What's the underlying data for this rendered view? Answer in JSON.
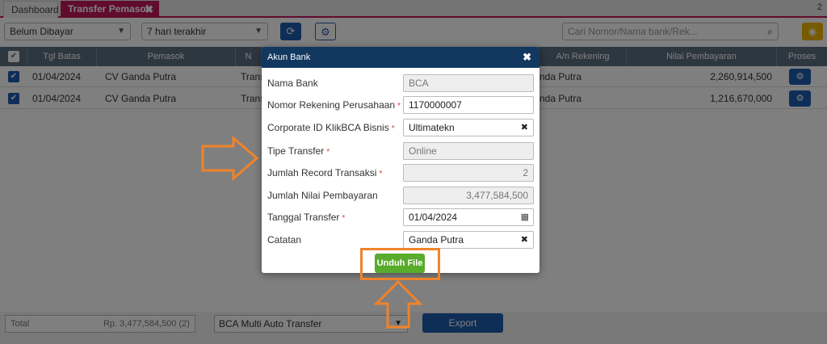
{
  "tabs": [
    {
      "label": "Dashboard"
    },
    {
      "label": "Transfer Pemasok",
      "close": "✖"
    }
  ],
  "tab_count": "2",
  "toolbar": {
    "status_value": "Belum Dibayar",
    "range_value": "7 hari terakhir",
    "search_placeholder": "Cari Nomor/Nama bank/Rek..."
  },
  "table": {
    "columns": [
      "Tgl Batas Transfer",
      "Pemasok",
      "N",
      "A/n Rekening",
      "Nilai Pembayaran",
      "Proses"
    ],
    "rows": [
      {
        "date": "01/04/2024",
        "supplier": "CV Ganda Putra",
        "method": "Trans",
        "account_name": "nda Putra",
        "amount": "2,260,914,500"
      },
      {
        "date": "01/04/2024",
        "supplier": "CV Ganda Putra",
        "method": "Trans",
        "account_name": "nda Putra",
        "amount": "1,216,670,000"
      }
    ]
  },
  "footer": {
    "total_label": "Total",
    "total_value": "Rp. 3,477,584,500 (2)",
    "method_value": "BCA Multi Auto Transfer",
    "export_label": "Export"
  },
  "modal": {
    "title": "Akun Bank",
    "close": "✖",
    "fields": [
      {
        "label": "Nama Bank",
        "value": "BCA",
        "required": false
      },
      {
        "label": "Nomor Rekening Perusahaan",
        "value": "1170000007",
        "required": true
      },
      {
        "label": "Corporate ID KlikBCA Bisnis",
        "value": "Ultimatekn",
        "required": true
      },
      {
        "label": "Tipe Transfer",
        "value": "Online",
        "required": true
      },
      {
        "label": "Jumlah Record Transaksi",
        "value": "2",
        "required": true
      },
      {
        "label": "Jumlah Nilai Pembayaran",
        "value": "3,477,584,500",
        "required": false
      },
      {
        "label": "Tanggal Transfer",
        "value": "01/04/2024",
        "required": true
      },
      {
        "label": "Catatan",
        "value": "Ganda Putra",
        "required": false
      }
    ],
    "required_mark": "*",
    "download_label": "Unduh File"
  },
  "colors": {
    "accent_tab": "#c2185b",
    "primary": "#1f5cae",
    "modal_header": "#12385f",
    "download": "#59ab2c",
    "annotation": "#f0832a"
  }
}
